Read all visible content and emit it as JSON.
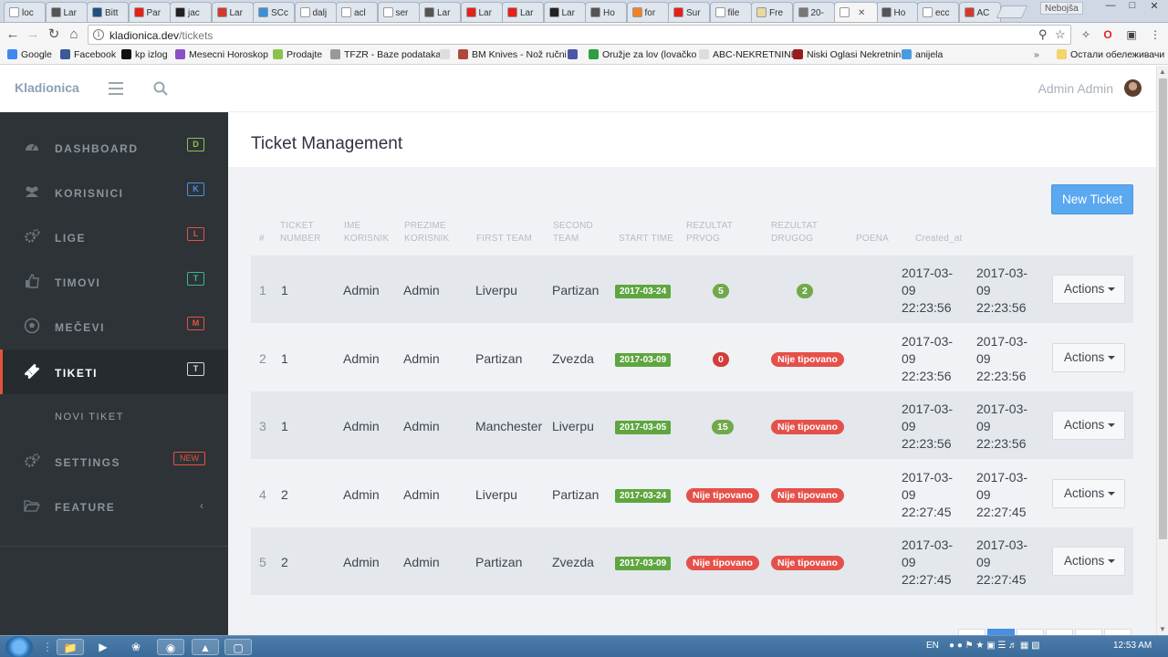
{
  "browser": {
    "tabs": [
      {
        "label": "loc",
        "color": "#ffffff"
      },
      {
        "label": "Lar",
        "color": "#555555"
      },
      {
        "label": "Bitt",
        "color": "#205081"
      },
      {
        "label": "Par",
        "color": "#e62117"
      },
      {
        "label": "jac",
        "color": "#222222"
      },
      {
        "label": "Lar",
        "color": "#d23a2e"
      },
      {
        "label": "SCc",
        "color": "#3b8fd9"
      },
      {
        "label": "dalj",
        "color": "#ffffff"
      },
      {
        "label": "acl",
        "color": "#ffffff"
      },
      {
        "label": "ser",
        "color": "#ffffff"
      },
      {
        "label": "Lar",
        "color": "#555555"
      },
      {
        "label": "Lar",
        "color": "#e62117"
      },
      {
        "label": "Lar",
        "color": "#e62117"
      },
      {
        "label": "Lar",
        "color": "#222222"
      },
      {
        "label": "Ho",
        "color": "#555555"
      },
      {
        "label": "for",
        "color": "#f48024"
      },
      {
        "label": "Sur",
        "color": "#e62117"
      },
      {
        "label": "file",
        "color": "#ffffff"
      },
      {
        "label": "Fre",
        "color": "#e8d9a0"
      },
      {
        "label": "20-",
        "color": "#777777"
      },
      {
        "label": "",
        "color": "#ffffff"
      },
      {
        "label": "Ho",
        "color": "#555555"
      },
      {
        "label": "ecc",
        "color": "#ffffff"
      },
      {
        "label": "AC",
        "color": "#d23a2e"
      }
    ],
    "profile_name": "Nebojša",
    "url_host": "kladionica.dev",
    "url_path": "/tickets"
  },
  "bookmarks": [
    {
      "label": "Google",
      "color": "#4285f4"
    },
    {
      "label": "Facebook",
      "color": "#3b5998"
    },
    {
      "label": "kp izlog",
      "color": "#111111"
    },
    {
      "label": "Mesecni Horoskop",
      "color": "#8a4fc7"
    },
    {
      "label": "Prodajte",
      "color": "#8bc34a"
    },
    {
      "label": "TFZR - Baze podataka",
      "color": "#999999"
    },
    {
      "label": "",
      "color": "#dddddd"
    },
    {
      "label": "BM Knives - Nož ručni",
      "color": "#b0483a"
    },
    {
      "label": "",
      "color": "#4a56a6"
    },
    {
      "label": "Oružje za lov (lovačko",
      "color": "#2e9e3f"
    },
    {
      "label": "ABC-NEKRETNINE",
      "color": "#dddddd"
    },
    {
      "label": "Niski Oglasi Nekretnin",
      "color": "#9b1b1b"
    },
    {
      "label": "anijela",
      "color": "#4a9be0"
    },
    {
      "label": "Остали обележивачи",
      "color": "#f3d36b"
    }
  ],
  "app": {
    "brand": "Kladionica",
    "user": "Admin Admin",
    "page_title": "Ticket Management",
    "new_ticket_label": "New Ticket",
    "actions_label": "Actions"
  },
  "sidebar": [
    {
      "label": "DASHBOARD",
      "badge": "D",
      "badge_color": "#8bc34a",
      "icon": "dashboard-icon"
    },
    {
      "label": "KORISNICI",
      "badge": "K",
      "badge_color": "#4a90e2",
      "icon": "users-icon"
    },
    {
      "label": "LIGE",
      "badge": "L",
      "badge_color": "#e2533d",
      "icon": "gears-icon"
    },
    {
      "label": "TIMOVI",
      "badge": "T",
      "badge_color": "#3cb68f",
      "icon": "thumbs-up-icon"
    },
    {
      "label": "MEČEVI",
      "badge": "M",
      "badge_color": "#e2533d",
      "icon": "soccer-ball-icon"
    },
    {
      "label": "TIKETI",
      "badge": "T",
      "badge_color": "#d8d8d8",
      "icon": "ticket-icon"
    },
    {
      "label": "NOVI TIKET",
      "badge": "",
      "badge_color": "",
      "icon": ""
    },
    {
      "label": "SETTINGS",
      "badge": "NEW",
      "badge_color": "#e2533d",
      "icon": "settings-icon"
    },
    {
      "label": "FEATURE",
      "badge": "",
      "badge_color": "",
      "icon": "folder-open-icon"
    }
  ],
  "table": {
    "headers": [
      [
        "#"
      ],
      [
        "TICKET",
        "NUMBER"
      ],
      [
        "IME",
        "KORISNIK"
      ],
      [
        "PREZIME",
        "KORISNIK"
      ],
      [
        "FIRST TEAM"
      ],
      [
        "SECOND",
        "TEAM"
      ],
      [
        "START TIME"
      ],
      [
        "REZULTAT",
        "PRVOG"
      ],
      [
        "REZULTAT",
        "DRUGOG"
      ],
      [
        "POENA"
      ],
      [
        "Created_at"
      ]
    ],
    "rows": [
      {
        "idx": "1",
        "ticket": "1",
        "ime": "Admin",
        "prezime": "Admin",
        "first": "Liverpu",
        "second": "Partizan",
        "start": "2017-03-24",
        "r1": "5",
        "r1_type": "green",
        "r2": "2",
        "r2_type": "green",
        "c1": "2017-03-",
        "c2": "09",
        "c3": "22:23:56",
        "u1": "2017-03-",
        "u2": "09",
        "u3": "22:23:56"
      },
      {
        "idx": "2",
        "ticket": "1",
        "ime": "Admin",
        "prezime": "Admin",
        "first": "Partizan",
        "second": "Zvezda",
        "start": "2017-03-09",
        "r1": "0",
        "r1_type": "red",
        "r2": "Nije tipovano",
        "r2_type": "nt",
        "c1": "2017-03-",
        "c2": "09",
        "c3": "22:23:56",
        "u1": "2017-03-",
        "u2": "09",
        "u3": "22:23:56"
      },
      {
        "idx": "3",
        "ticket": "1",
        "ime": "Admin",
        "prezime": "Admin",
        "first": "Manchester",
        "second": "Liverpu",
        "start": "2017-03-05",
        "r1": "15",
        "r1_type": "green",
        "r2": "Nije tipovano",
        "r2_type": "nt",
        "c1": "2017-03-",
        "c2": "09",
        "c3": "22:23:56",
        "u1": "2017-03-",
        "u2": "09",
        "u3": "22:23:56"
      },
      {
        "idx": "4",
        "ticket": "2",
        "ime": "Admin",
        "prezime": "Admin",
        "first": "Liverpu",
        "second": "Partizan",
        "start": "2017-03-24",
        "r1": "Nije tipovano",
        "r1_type": "nt",
        "r2": "Nije tipovano",
        "r2_type": "nt",
        "c1": "2017-03-",
        "c2": "09",
        "c3": "22:27:45",
        "u1": "2017-03-",
        "u2": "09",
        "u3": "22:27:45"
      },
      {
        "idx": "5",
        "ticket": "2",
        "ime": "Admin",
        "prezime": "Admin",
        "first": "Partizan",
        "second": "Zvezda",
        "start": "2017-03-09",
        "r1": "Nije tipovano",
        "r1_type": "nt",
        "r2": "Nije tipovano",
        "r2_type": "nt",
        "c1": "2017-03-",
        "c2": "09",
        "c3": "22:27:45",
        "u1": "2017-03-",
        "u2": "09",
        "u3": "22:27:45"
      }
    ]
  },
  "taskbar": {
    "lang": "EN",
    "clock": "12:53 AM"
  }
}
